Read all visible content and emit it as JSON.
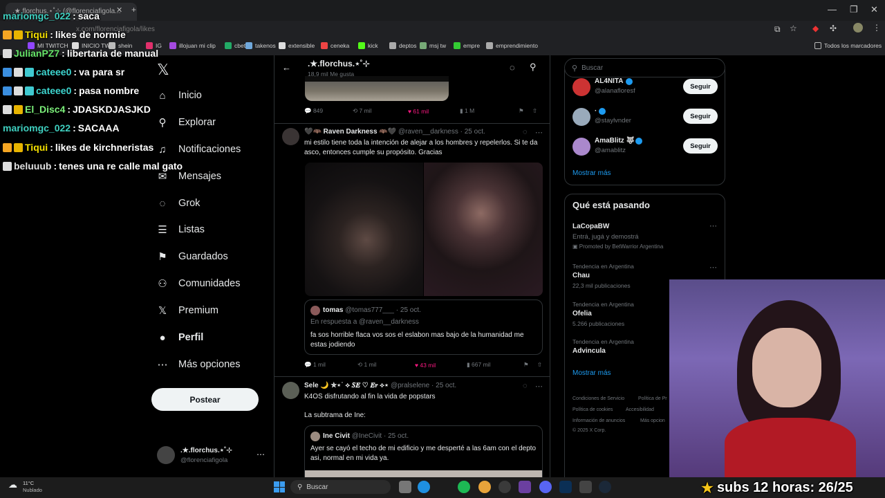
{
  "browser": {
    "tab_title": ".★.florchus.⋆˚⊹ (@florenciafigola...",
    "url": "x.com/florenciafigola/likes",
    "bookmarks": [
      "MI TWITCH",
      "INICIO TW",
      "shein",
      "IG",
      "illojuan mi clip",
      "cbet",
      "takenos",
      "extensible",
      "ceneka",
      "kick",
      "deptos",
      "msj tw",
      "empre",
      "emprendimiento"
    ],
    "all_bookmarks": "Todos los marcadores"
  },
  "sidebar": {
    "items": [
      {
        "label": "Inicio",
        "icon": "home-icon",
        "glyph": "⌂"
      },
      {
        "label": "Explorar",
        "icon": "search-icon",
        "glyph": "⚲"
      },
      {
        "label": "Notificaciones",
        "icon": "bell-icon",
        "glyph": "♫"
      },
      {
        "label": "Mensajes",
        "icon": "mail-icon",
        "glyph": "✉"
      },
      {
        "label": "Grok",
        "icon": "grok-icon",
        "glyph": "◌"
      },
      {
        "label": "Listas",
        "icon": "list-icon",
        "glyph": "☰"
      },
      {
        "label": "Guardados",
        "icon": "bookmark-icon",
        "glyph": "⚑"
      },
      {
        "label": "Comunidades",
        "icon": "people-icon",
        "glyph": "⚇"
      },
      {
        "label": "Premium",
        "icon": "x-logo-icon",
        "glyph": "𝕏"
      },
      {
        "label": "Perfil",
        "icon": "person-icon",
        "glyph": "●"
      },
      {
        "label": "Más opciones",
        "icon": "more-icon",
        "glyph": "⋯"
      }
    ],
    "post_button": "Postear",
    "account_name": ".★.florchus.⋆˚⊹",
    "account_handle": "@florenciafigola"
  },
  "header": {
    "name": ".★.florchus.⋆˚⊹",
    "subtitle": "18,9 mil Me gusta"
  },
  "posts": [
    {
      "replies": "849",
      "reposts": "7 mil",
      "likes": "61 mil",
      "views": "1 M"
    },
    {
      "author": "🖤🦇 Raven Darkness 🦇🖤",
      "handle": "@raven__darkness",
      "date": "· 25 oct.",
      "text": "mi estilo tiene toda la intención de alejar a los hombres y repelerlos. Si te da asco, entonces cumple su propósito. Gracias",
      "quote": {
        "author": "tomas",
        "handle": "@tomas777___",
        "date": "· 25 oct.",
        "reply_to": "En respuesta a @raven__darkness",
        "text": "fa sos horrible flaca vos sos el eslabon mas bajo de la humanidad me estas jodiendo"
      },
      "replies": "1 mil",
      "reposts": "1 mil",
      "likes": "43 mil",
      "views": "667 mil"
    },
    {
      "author": "Sele 🌙 ✮⋆˙ ⟡ 𝑺𝑬 ♡ 𝑬𝒓 ⟡⋆",
      "handle": "@pralselene",
      "date": "· 25 oct.",
      "text": "K4OS disfrutando al fin la vida de popstars",
      "text2": "La subtrama de Ine:",
      "quote": {
        "author": "Ine Civit",
        "handle": "@IneCivit",
        "date": "· 25 oct.",
        "text": "Ayer se cayó el techo de mi edificio y me desperté a las 6am con el depto asi, normal en mi vida ya."
      }
    }
  ],
  "right": {
    "search_placeholder": "Buscar",
    "follow": [
      {
        "name": "AL4NITA",
        "handle": "@alanafloresf",
        "button": "Seguir",
        "color": "#c33"
      },
      {
        "name": "·",
        "handle": "@staylvnder",
        "button": "Seguir",
        "color": "#9ab"
      },
      {
        "name": "AmaBlitz 🐺",
        "handle": "@amablitz",
        "button": "Seguir",
        "color": "#a8c"
      }
    ],
    "show_more": "Mostrar más",
    "trending_title": "Qué está pasando",
    "promo": {
      "title": "LaCopaBW",
      "desc": "Entrá, jugá y demostrá",
      "promoted": "Promoted by BetWarrior Argentina"
    },
    "trends": [
      {
        "context": "Tendencia en Argentina",
        "name": "Chau",
        "count": "22,3 mil publicaciones"
      },
      {
        "context": "Tendencia en Argentina",
        "name": "Ofelia",
        "count": "5.266 publicaciones"
      },
      {
        "context": "Tendencia en Argentina",
        "name": "Advincula",
        "count": ""
      }
    ],
    "show_more_2": "Mostrar más",
    "footer": [
      "Condiciones de Servicio",
      "Política de Pr",
      "Política de cookies",
      "Accesibilidad",
      "Información de anuncios",
      "Más opcion",
      "© 2025 X Corp."
    ]
  },
  "chat": [
    {
      "user": "mariomgc_022",
      "msg": "saca",
      "color": "#3fd0c0",
      "badges": []
    },
    {
      "user": "Tiqui",
      "msg": "likes de normie",
      "color": "#f5e000",
      "badges": [
        "#f5a623",
        "#e8b400"
      ]
    },
    {
      "user": "JulianPZ7",
      "msg": "libertaria de manual",
      "color": "#67e66a",
      "badges": [
        "#ddd"
      ]
    },
    {
      "user": "cateee0",
      "msg": "va para sr",
      "color": "#3dd6d0",
      "badges": [
        "#3b8fe0",
        "#ddd",
        "#3fc9d0"
      ]
    },
    {
      "user": "cateee0",
      "msg": "pasa nombre",
      "color": "#3dd6d0",
      "badges": [
        "#3b8fe0",
        "#ddd",
        "#3fc9d0"
      ]
    },
    {
      "user": "El_Disc4",
      "msg": "JDASKDJASJKD",
      "color": "#7cf07a",
      "badges": [
        "#ddd",
        "#e8b400"
      ]
    },
    {
      "user": "mariomgc_022",
      "msg": "SACAAA",
      "color": "#3fd0c0",
      "badges": []
    },
    {
      "user": "Tiqui",
      "msg": "likes de kirchneristas",
      "color": "#f5e000",
      "badges": [
        "#f5a623",
        "#e8b400"
      ]
    },
    {
      "user": "beluuub",
      "msg": "tenes una re calle mal gato",
      "color": "#e0e0e0",
      "badges": [
        "#ddd"
      ]
    }
  ],
  "taskbar": {
    "weather_temp": "11°C",
    "weather_desc": "Nublado",
    "search": "Buscar"
  },
  "overlay": {
    "subs_text": "subs 12 horas: 26/25"
  }
}
